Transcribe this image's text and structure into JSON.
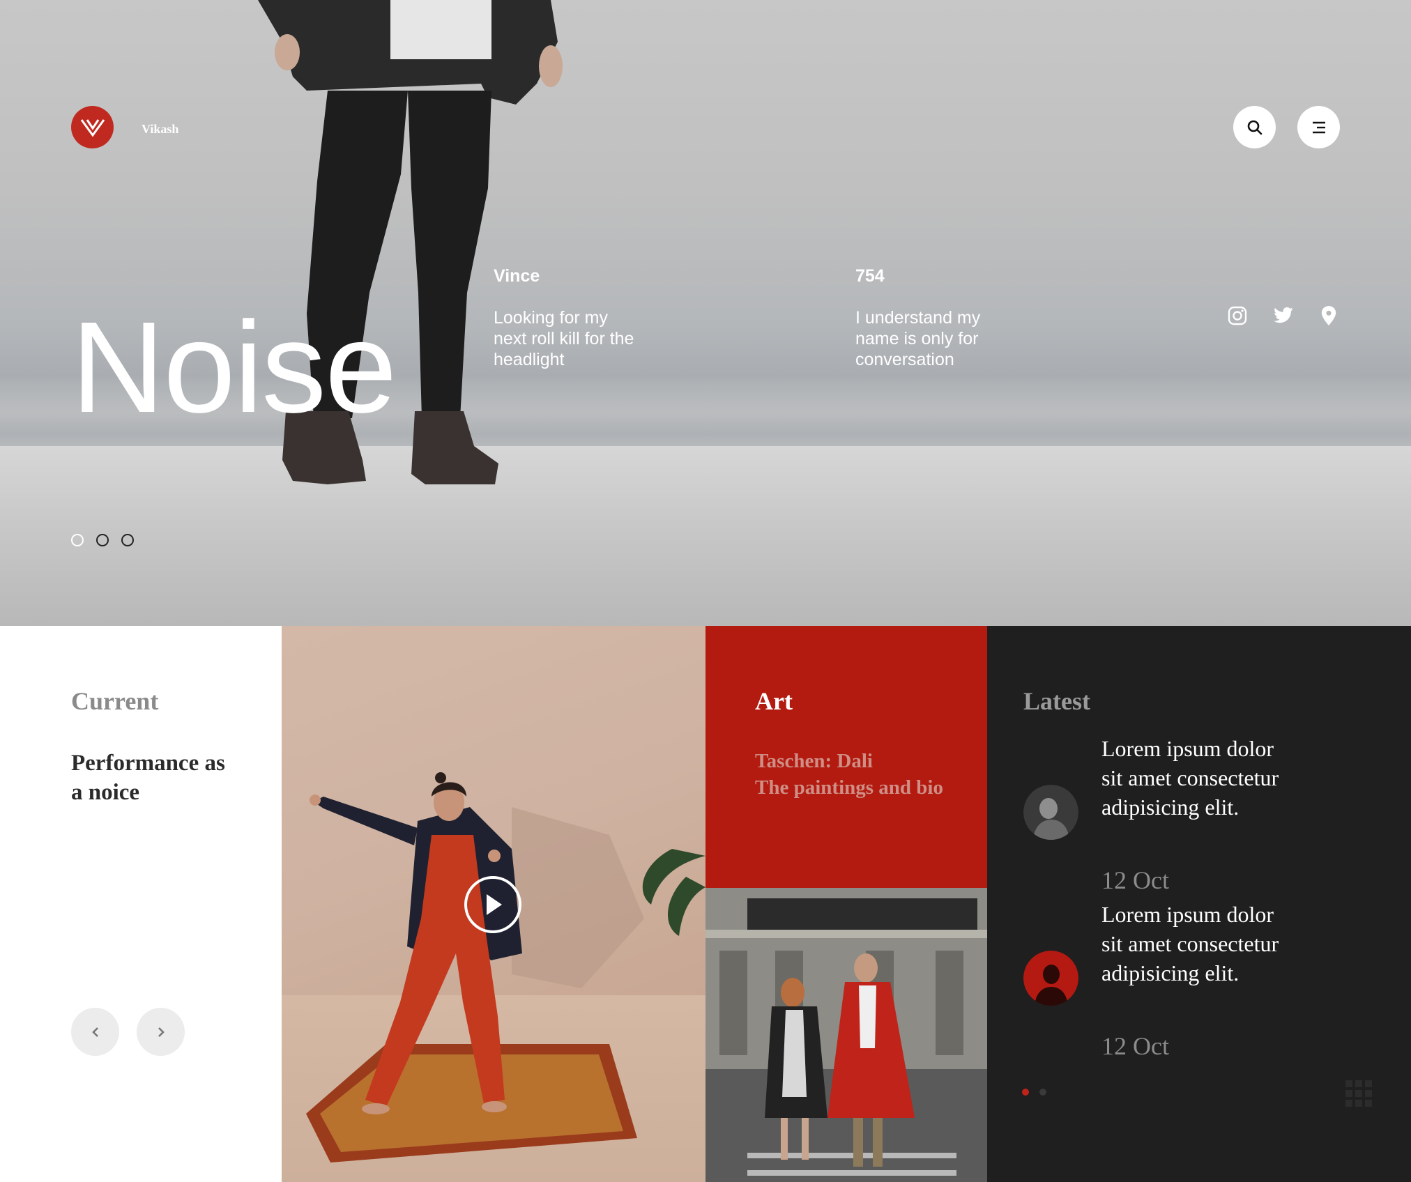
{
  "header": {
    "brand_name": "Vikash",
    "logo_icon": "v-logo-icon",
    "search_icon": "search-icon",
    "menu_icon": "menu-icon"
  },
  "hero": {
    "title": "Noise",
    "meta": [
      {
        "heading": "Vince",
        "text": "Looking for my next roll kill for the headlight"
      },
      {
        "heading": "754",
        "text": "I understand my name is only for conversation"
      }
    ],
    "social_icons": [
      "instagram-icon",
      "twitter-icon",
      "location-pin-icon"
    ],
    "slides": {
      "count": 3,
      "active": 1
    }
  },
  "current": {
    "label": "Current",
    "title": "Performance as a noice",
    "prev_icon": "chevron-left-icon",
    "next_icon": "chevron-right-icon"
  },
  "video": {
    "play_icon": "play-icon"
  },
  "art": {
    "label": "Art",
    "link_line1": "Taschen: Dali",
    "link_line2": "The paintings and bio"
  },
  "latest": {
    "label": "Latest",
    "items": [
      {
        "text": "Lorem ipsum dolor sit amet consectetur adipisicing elit.",
        "date": "12 Oct"
      },
      {
        "text": "Lorem ipsum dolor sit amet consectetur adipisicing elit.",
        "date": "12 Oct"
      }
    ],
    "pager": {
      "count": 2,
      "active": 1
    }
  },
  "colors": {
    "accent_red": "#c0291f",
    "art_red": "#b31b10",
    "dark_panel": "#1f1f1f"
  }
}
